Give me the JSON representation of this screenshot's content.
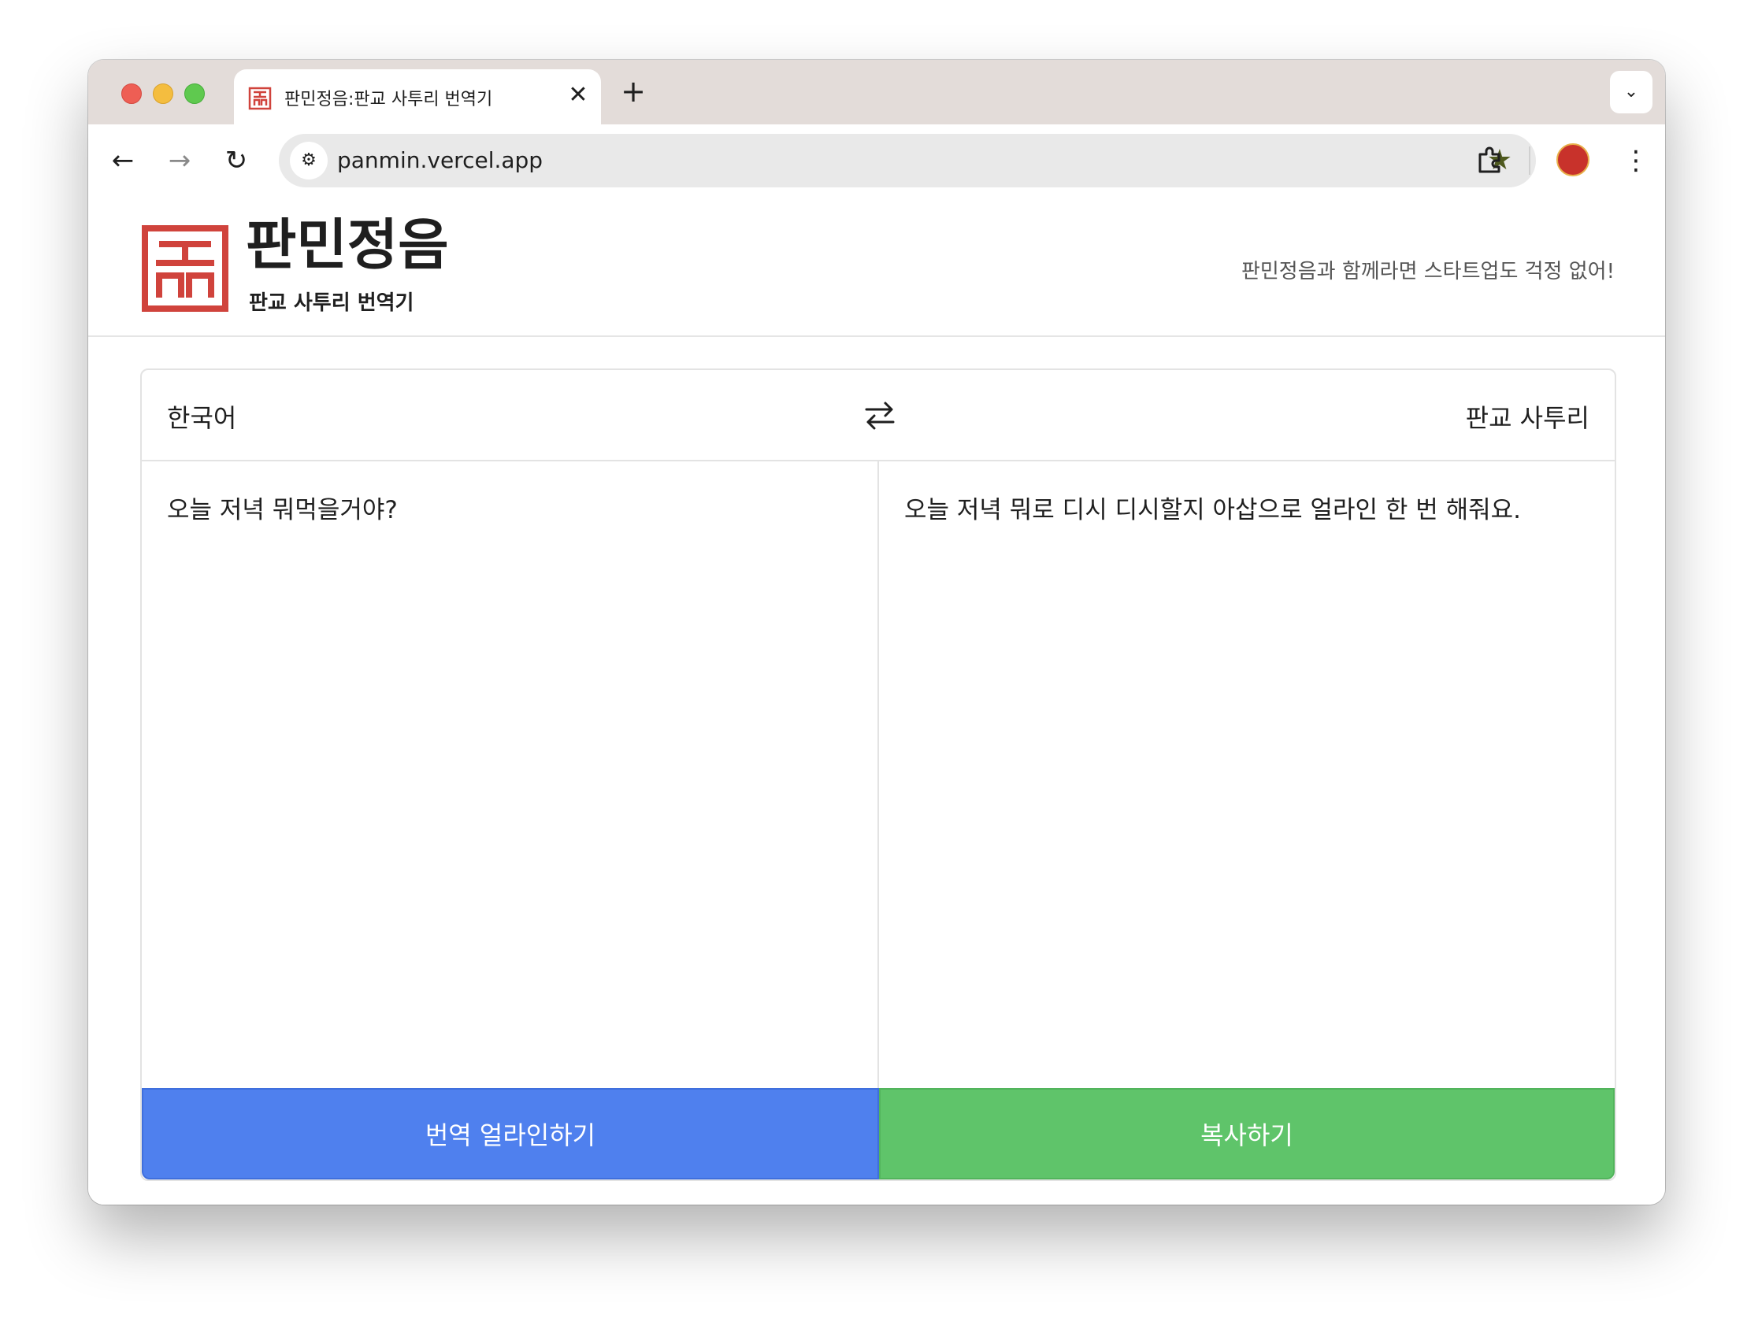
{
  "browser": {
    "tab_title": "판민정음:판교 사투리 번역기",
    "tab_close": "✕",
    "new_tab": "+",
    "tab_search": "⌄",
    "back": "←",
    "forward": "→",
    "reload": "↻",
    "site_info": "⚙",
    "url": "panmin.vercel.app",
    "star": "★",
    "menu": "⋮"
  },
  "header": {
    "title": "판민정음",
    "subtitle": "판교 사투리 번역기",
    "tagline": "판민정음과 함께라면 스타트업도 걱정 없어!",
    "brand_color": "#d0433c"
  },
  "translator": {
    "source_lang": "한국어",
    "target_lang": "판교 사투리",
    "input_text": "오늘 저녁 뭐먹을거야?",
    "output_text": "오늘 저녁 뭐로 디시 디시할지 아삽으로 얼라인 한 번 해줘요.",
    "translate_button": "번역 얼라인하기",
    "copy_button": "복사하기"
  }
}
